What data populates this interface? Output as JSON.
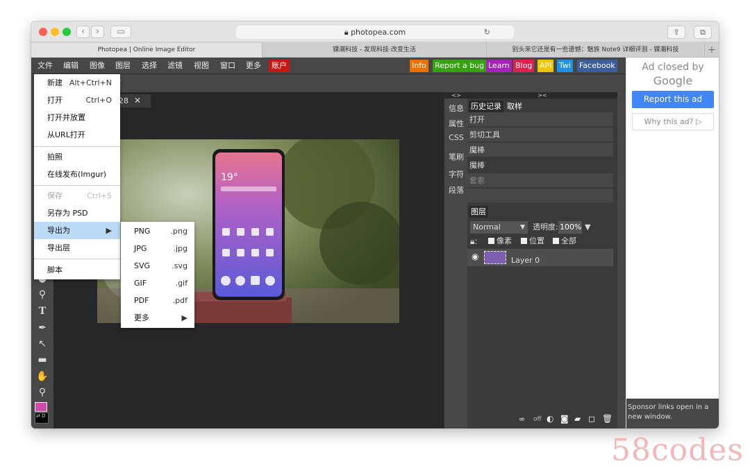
{
  "browser": {
    "url": "photopea.com",
    "tabs": [
      {
        "title": "Photopea | Online Image Editor"
      },
      {
        "title": "锞潮科技 - 发现科技·改变生活"
      },
      {
        "title": "别头来它还是有一些遗憾：魅族 Note9 详细评测 - 锞潮科技"
      }
    ]
  },
  "app": {
    "menubar": [
      "文件",
      "编辑",
      "图像",
      "图层",
      "选择",
      "滤镜",
      "视图",
      "窗口",
      "更多"
    ],
    "account": "账户",
    "right_buttons": [
      {
        "label": "Info",
        "color": "#f06e00"
      },
      {
        "label": "Report a bug",
        "color": "#34a40e"
      },
      {
        "label": "Learn",
        "color": "#a91fbf"
      },
      {
        "label": "Blog",
        "color": "#e0204f"
      },
      {
        "label": "API",
        "color": "#f2c400"
      },
      {
        "label": "Twi",
        "color": "#1e91e8"
      },
      {
        "label": "Facebook",
        "color": "#3b5e9c"
      }
    ],
    "doc_tab_fragment": "28",
    "side_tabs": [
      "信息",
      "属性",
      "CSS",
      "笔刷",
      "字符",
      "段落"
    ],
    "history": {
      "tabs": [
        "历史记录",
        "取样"
      ],
      "items": [
        "打开",
        "剪切工具",
        "魔棒",
        "魔棒",
        "套索"
      ]
    },
    "layers": {
      "tab": "图层",
      "blend": "Normal",
      "opacity_label": "透明度:",
      "opacity_value": "100%",
      "lock_pixels": "像素",
      "lock_position": "位置",
      "lock_all": "全部",
      "layer_name": "Layer 0"
    },
    "bottom_off": "off",
    "swatch_fg": "#d04aaa"
  },
  "file_menu": {
    "items": [
      {
        "label": "新建",
        "shortcut": "Alt+Ctrl+N"
      },
      {
        "label": "打开",
        "shortcut": "Ctrl+O"
      },
      {
        "label": "打开并放置",
        "shortcut": ""
      },
      {
        "label": "从URL打开",
        "shortcut": ""
      },
      {
        "label": "拍照",
        "shortcut": ""
      },
      {
        "label": "在线发布(Imgur)",
        "shortcut": ""
      },
      {
        "label": "保存",
        "shortcut": "Ctrl+S"
      },
      {
        "label": "另存为 PSD",
        "shortcut": ""
      },
      {
        "label": "导出为",
        "shortcut": "▶"
      },
      {
        "label": "导出层",
        "shortcut": ""
      },
      {
        "label": "脚本",
        "shortcut": ""
      }
    ]
  },
  "export_menu": {
    "items": [
      {
        "label": "PNG",
        "ext": ".png"
      },
      {
        "label": "JPG",
        "ext": ".jpg"
      },
      {
        "label": "SVG",
        "ext": ".svg"
      },
      {
        "label": "GIF",
        "ext": ".gif"
      },
      {
        "label": "PDF",
        "ext": ".pdf"
      },
      {
        "label": "更多",
        "ext": "▶"
      }
    ]
  },
  "ad": {
    "closed_line1": "Ad closed by",
    "closed_line2": "Google",
    "report": "Report this ad",
    "why": "Why this ad? ▷",
    "sponsor": "Sponsor links open in a new window."
  },
  "phone": {
    "time": "19°"
  },
  "watermark": "58codes"
}
